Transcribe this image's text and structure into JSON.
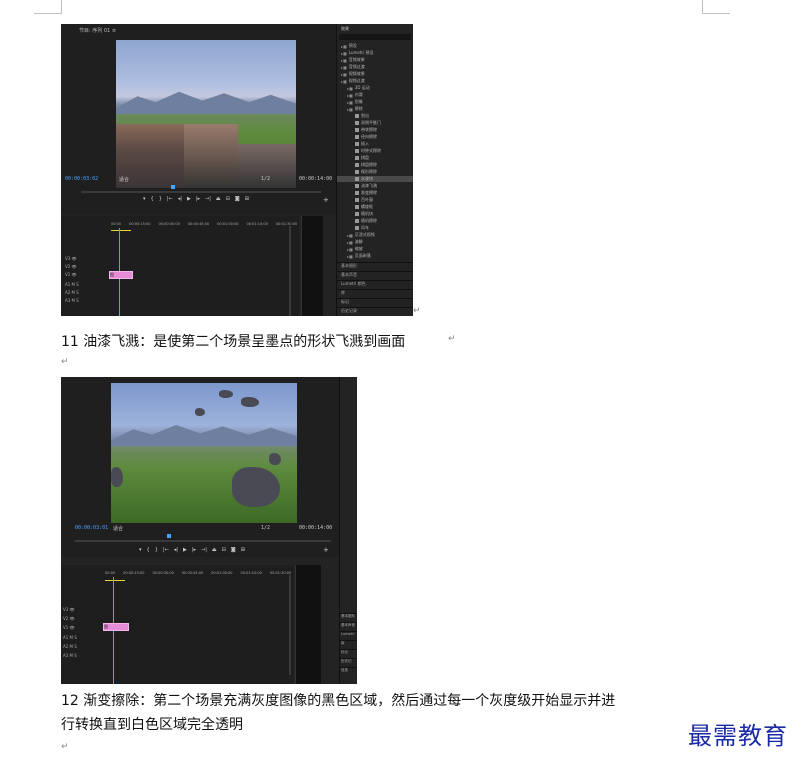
{
  "screenshot1": {
    "panel_title": "节目: 序列 01 ≡",
    "time_current": "00:00:03:02",
    "fit_label": "适合",
    "quality": "1/2",
    "time_total": "00:00:14:00",
    "effects_panel": {
      "title": "效果",
      "items": [
        {
          "label": "预设",
          "type": "folder",
          "selected": false
        },
        {
          "label": "Lumetri 预设",
          "type": "folder",
          "selected": false
        },
        {
          "label": "音频效果",
          "type": "folder",
          "selected": false
        },
        {
          "label": "音频过渡",
          "type": "folder",
          "selected": false
        },
        {
          "label": "视频效果",
          "type": "folder",
          "selected": false
        },
        {
          "label": "视频过渡",
          "type": "folder",
          "selected": false
        },
        {
          "label": "3D 运动",
          "type": "folder",
          "selected": false
        },
        {
          "label": "内滑",
          "type": "folder",
          "selected": false
        },
        {
          "label": "划像",
          "type": "folder",
          "selected": false
        },
        {
          "label": "擦除",
          "type": "folder",
          "selected": false
        },
        {
          "label": "划出",
          "type": "effect",
          "selected": false
        },
        {
          "label": "双侧平推门",
          "type": "effect",
          "selected": false
        },
        {
          "label": "带状擦除",
          "type": "effect",
          "selected": false
        },
        {
          "label": "径向擦除",
          "type": "effect",
          "selected": false
        },
        {
          "label": "插入",
          "type": "effect",
          "selected": false
        },
        {
          "label": "时钟式擦除",
          "type": "effect",
          "selected": false
        },
        {
          "label": "棋盘",
          "type": "effect",
          "selected": false
        },
        {
          "label": "棋盘擦除",
          "type": "effect",
          "selected": false
        },
        {
          "label": "楔形擦除",
          "type": "effect",
          "selected": false
        },
        {
          "label": "水波块",
          "type": "effect",
          "selected": true
        },
        {
          "label": "油漆飞溅",
          "type": "effect",
          "selected": false
        },
        {
          "label": "渐变擦除",
          "type": "effect",
          "selected": false
        },
        {
          "label": "百叶窗",
          "type": "effect",
          "selected": false
        },
        {
          "label": "螺旋框",
          "type": "effect",
          "selected": false
        },
        {
          "label": "随机块",
          "type": "effect",
          "selected": false
        },
        {
          "label": "随机擦除",
          "type": "effect",
          "selected": false
        },
        {
          "label": "风车",
          "type": "effect",
          "selected": false
        },
        {
          "label": "沉浸式视频",
          "type": "folder",
          "selected": false
        },
        {
          "label": "溶解",
          "type": "folder",
          "selected": false
        },
        {
          "label": "缩放",
          "type": "folder",
          "selected": false
        },
        {
          "label": "页面剥落",
          "type": "folder",
          "selected": false
        }
      ],
      "bottom": [
        "基本图形",
        "基本声音",
        "Lumetri 颜色",
        "库",
        "标记",
        "历史记录"
      ]
    },
    "timeline": {
      "ruler": [
        "00:00",
        "00:00:15:00",
        "00:00:30:00",
        "00:00:45:00",
        "00:01:00:00",
        "00:01:15:00",
        "00:01:30:00",
        "00:01:45"
      ],
      "tracks": [
        "V3",
        "V2",
        "V1",
        "A1",
        "A2",
        "A3"
      ],
      "clip_label": "图"
    },
    "meter_scale": [
      "0",
      "-6",
      "-12",
      "-18",
      "-24",
      "-30",
      "-36",
      "-42",
      "-48",
      "-54",
      "dB"
    ]
  },
  "caption1": "11 油漆飞溅：是使第二个场景呈墨点的形状飞溅到画面",
  "screenshot2": {
    "time_current": "00:00:03:01",
    "fit_label": "适合",
    "quality": "1/2",
    "time_total": "00:00:14:00",
    "bottom": [
      "基本图形",
      "基本声音",
      "Lumetri",
      "库",
      "标记",
      "历史记",
      "信息"
    ],
    "timeline": {
      "ruler": [
        "00:00",
        "00:00:15:00",
        "00:00:30:00",
        "00:00:45:00",
        "00:01:00:00",
        "00:01:15:00",
        "00:01:30:00",
        "00:01:45"
      ],
      "clip_label": "图"
    },
    "meter_scale": [
      "0",
      "-6",
      "-12",
      "-18",
      "-24",
      "-30",
      "-36",
      "-42",
      "-48",
      "-54",
      "dB"
    ]
  },
  "caption2_line1": "12  渐变擦除：第二个场景充满灰度图像的黑色区域，然后通过每一个灰度级开始显示并进",
  "caption2_line2": "行转换直到白色区域完全透明",
  "return_mark": "↵",
  "watermark": "最需教育",
  "colors": {
    "accent_blue": "#4aa3ff",
    "clip_pink": "#e58bd8",
    "panel_bg": "#232323",
    "watermark_blue": "#1a2aa6"
  }
}
